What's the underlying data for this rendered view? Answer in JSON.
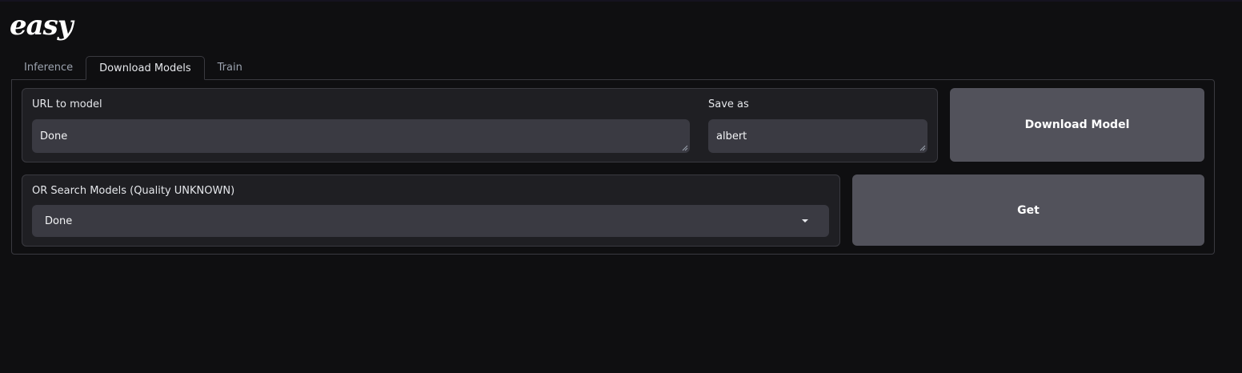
{
  "app": {
    "logo_text": "easy"
  },
  "tabs": [
    {
      "label": "Inference"
    },
    {
      "label": "Download Models"
    },
    {
      "label": "Train"
    }
  ],
  "active_tab": "Download Models",
  "download": {
    "url_label": "URL to model",
    "url_value": "Done",
    "save_label": "Save as",
    "save_value": "albert",
    "download_button": "Download Model"
  },
  "search": {
    "label": "OR Search Models (Quality UNKNOWN)",
    "selected": "Done",
    "get_button": "Get"
  },
  "colors": {
    "background": "#0f0f11",
    "block": "#1f1f23",
    "input": "#3a3a42",
    "button": "#52525b",
    "border": "#3a3a40"
  }
}
